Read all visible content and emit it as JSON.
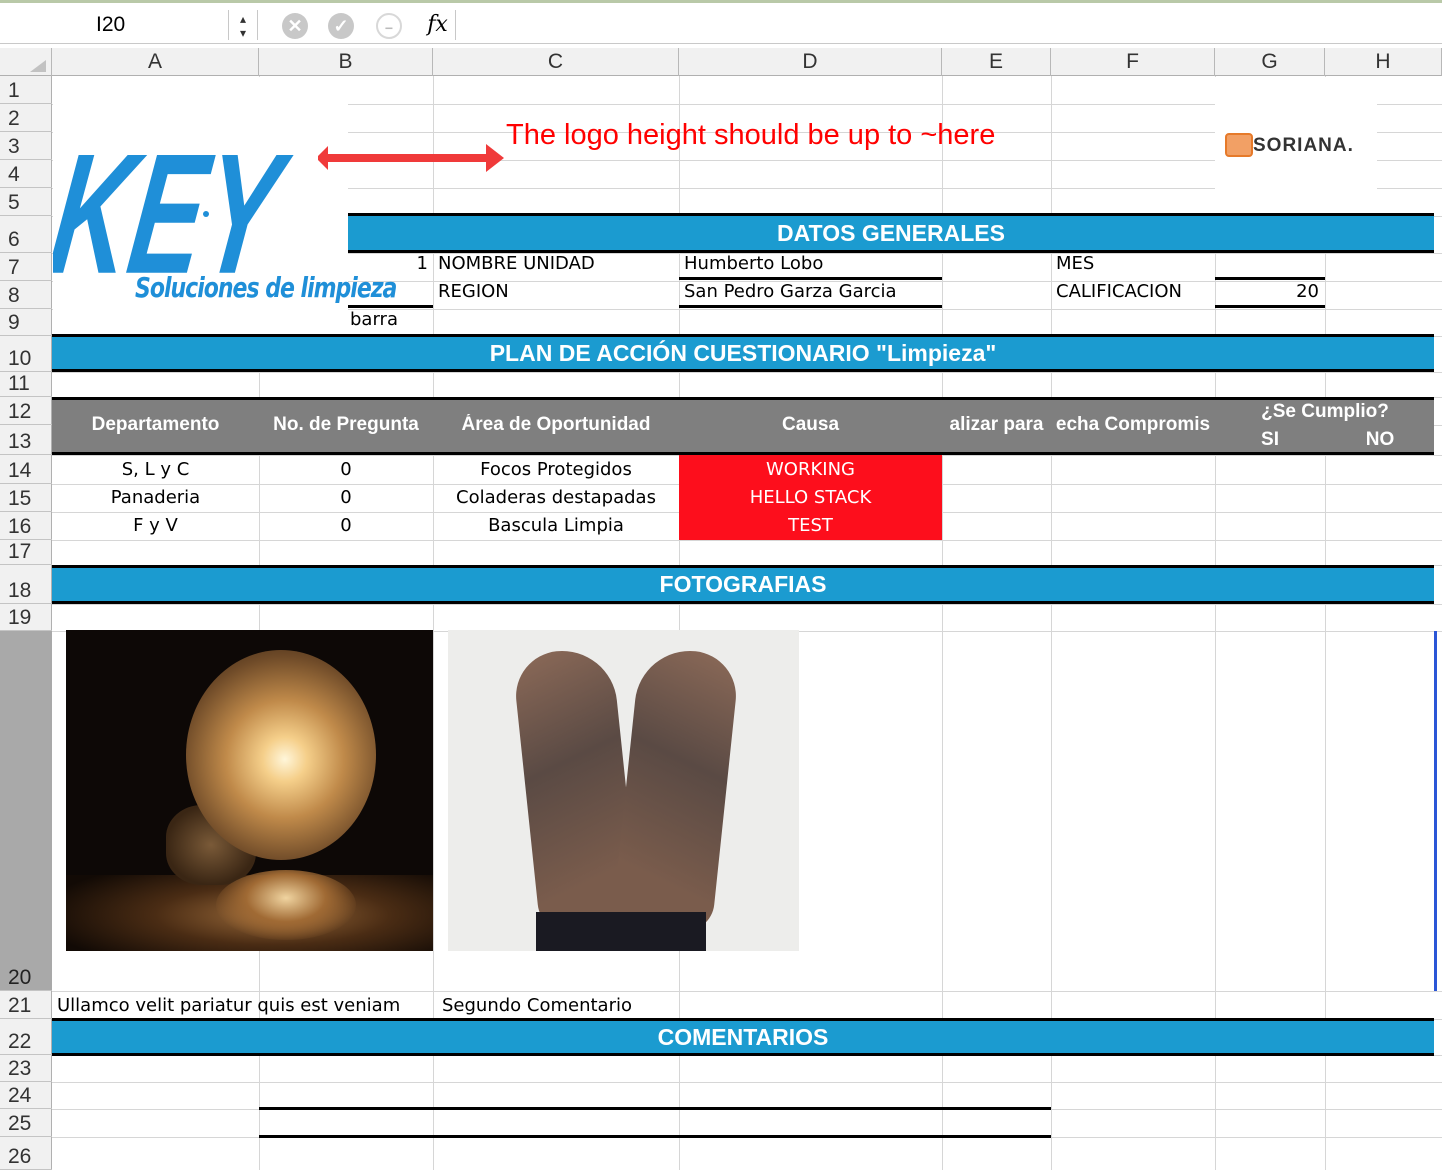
{
  "formula_bar": {
    "name_box": "I20",
    "stepper": "▴\n▾",
    "cancel": "✕",
    "confirm": "✓",
    "func": "−",
    "fx": "fx",
    "formula": ""
  },
  "columns": [
    "A",
    "B",
    "C",
    "D",
    "E",
    "F",
    "G",
    "H"
  ],
  "rows": [
    "1",
    "2",
    "3",
    "4",
    "5",
    "6",
    "7",
    "8",
    "9",
    "10",
    "11",
    "12",
    "13",
    "14",
    "15",
    "16",
    "17",
    "18",
    "19",
    "20",
    "21",
    "22",
    "23",
    "24",
    "25",
    "26"
  ],
  "logo": {
    "brand": "KEY",
    "tagline": "Soluciones de limpieza",
    "partner": "SORIANA."
  },
  "annotation": {
    "text": "The logo height should be up to ~here",
    "color": "#ff0000"
  },
  "datos_generales": {
    "title": "DATOS GENERALES",
    "unit_number": "1",
    "unit_label": "NOMBRE UNIDAD",
    "unit_value": "Humberto Lobo",
    "mes_label": "MES",
    "region_label": "REGION",
    "region_value": "San Pedro Garza Garcia",
    "calif_label": "CALIFICACION",
    "calif_value": "20",
    "barra": "barra"
  },
  "plan": {
    "title": "PLAN DE ACCIÓN  CUESTIONARIO \"Limpieza\"",
    "headers": [
      "Departamento",
      "No. de Pregunta",
      "Área de Oportunidad",
      "Causa",
      "alizar para",
      "echa Compromis",
      "¿Se Cumplio?",
      "SI",
      "NO"
    ],
    "rows": [
      {
        "dept": "S, L y C",
        "num": "0",
        "area": "Focos Protegidos",
        "causa": "WORKING"
      },
      {
        "dept": "Panaderia",
        "num": "0",
        "area": "Coladeras destapadas",
        "causa": "HELLO STACK"
      },
      {
        "dept": "F y V",
        "num": "0",
        "area": "Bascula Limpia",
        "causa": "TEST"
      }
    ]
  },
  "fotografias": {
    "title": "FOTOGRAFIAS",
    "comment1": "Ullamco velit pariatur quis est veniam",
    "comment2": "Segundo Comentario"
  },
  "comentarios": {
    "title": "COMENTARIOS"
  },
  "colors": {
    "bar_blue": "#1b9bd0",
    "header_gray": "#7f7f7f",
    "red_cell": "#fd0e1c",
    "key_blue": "#1f8fd8"
  }
}
